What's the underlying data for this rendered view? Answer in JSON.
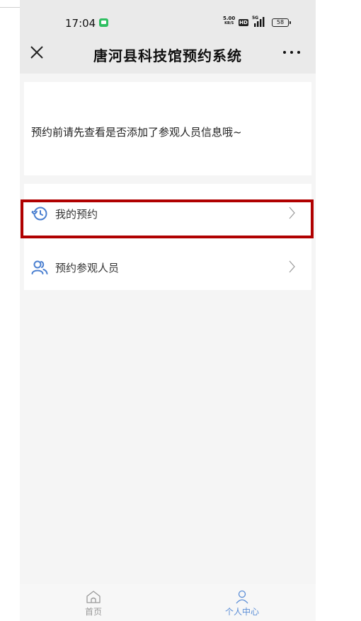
{
  "status_bar": {
    "time": "17:04",
    "net_speed_value": "5.00",
    "net_speed_unit": "KB/S",
    "hd_label": "HD",
    "network_type": "5G",
    "battery": "58"
  },
  "nav": {
    "title": "唐河县科技馆预约系统",
    "close_icon": "close-icon",
    "more_icon": "more-icon"
  },
  "notice": {
    "text": "预约前请先查看是否添加了参观人员信息哦~"
  },
  "menu": {
    "items": [
      {
        "label": "我的预约",
        "icon": "history-clock-icon"
      },
      {
        "label": "预约参观人员",
        "icon": "people-icon"
      }
    ]
  },
  "tabbar": {
    "tabs": [
      {
        "label": "首页",
        "icon": "home-icon",
        "active": false
      },
      {
        "label": "个人中心",
        "icon": "person-icon",
        "active": true
      }
    ]
  },
  "colors": {
    "accent": "#5a8dd6",
    "highlight": "#b00000",
    "status_green": "#2fbf61"
  }
}
